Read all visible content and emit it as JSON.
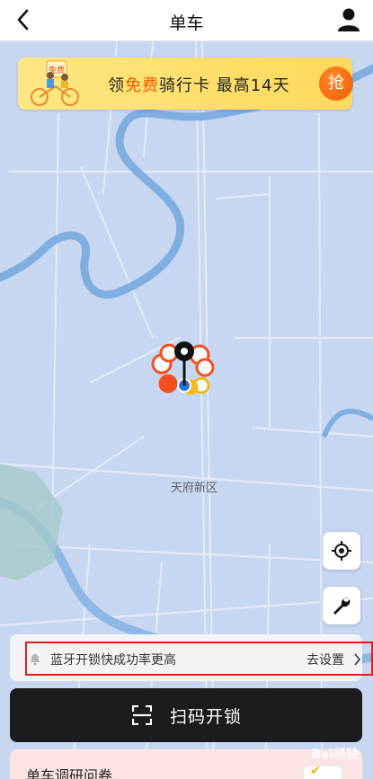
{
  "header": {
    "title": "单车",
    "back_icon": "chevron-left-icon",
    "user_icon": "user-icon"
  },
  "banner": {
    "text_prefix": "领",
    "text_highlight": "免费",
    "text_suffix": "骑行卡  最高14天",
    "grab_label": "抢",
    "art_tag": "免费",
    "accent": "#f05a00"
  },
  "map": {
    "area_label": "天府新区",
    "locate_icon": "locate-icon",
    "repair_icon": "wrench-icon"
  },
  "tip": {
    "message": "蓝牙开锁快成功率更高",
    "action": "去设置",
    "bell_icon": "bell-icon"
  },
  "scan": {
    "label": "扫码开锁",
    "icon": "scan-icon"
  },
  "survey": {
    "label": "单车调研问卷"
  },
  "watermark": "Bai经验",
  "colors": {
    "map_bg": "#c8d7f1",
    "river": "#7faee0",
    "highlight_border": "#e02020",
    "scan_bg": "#1c1c1e"
  }
}
